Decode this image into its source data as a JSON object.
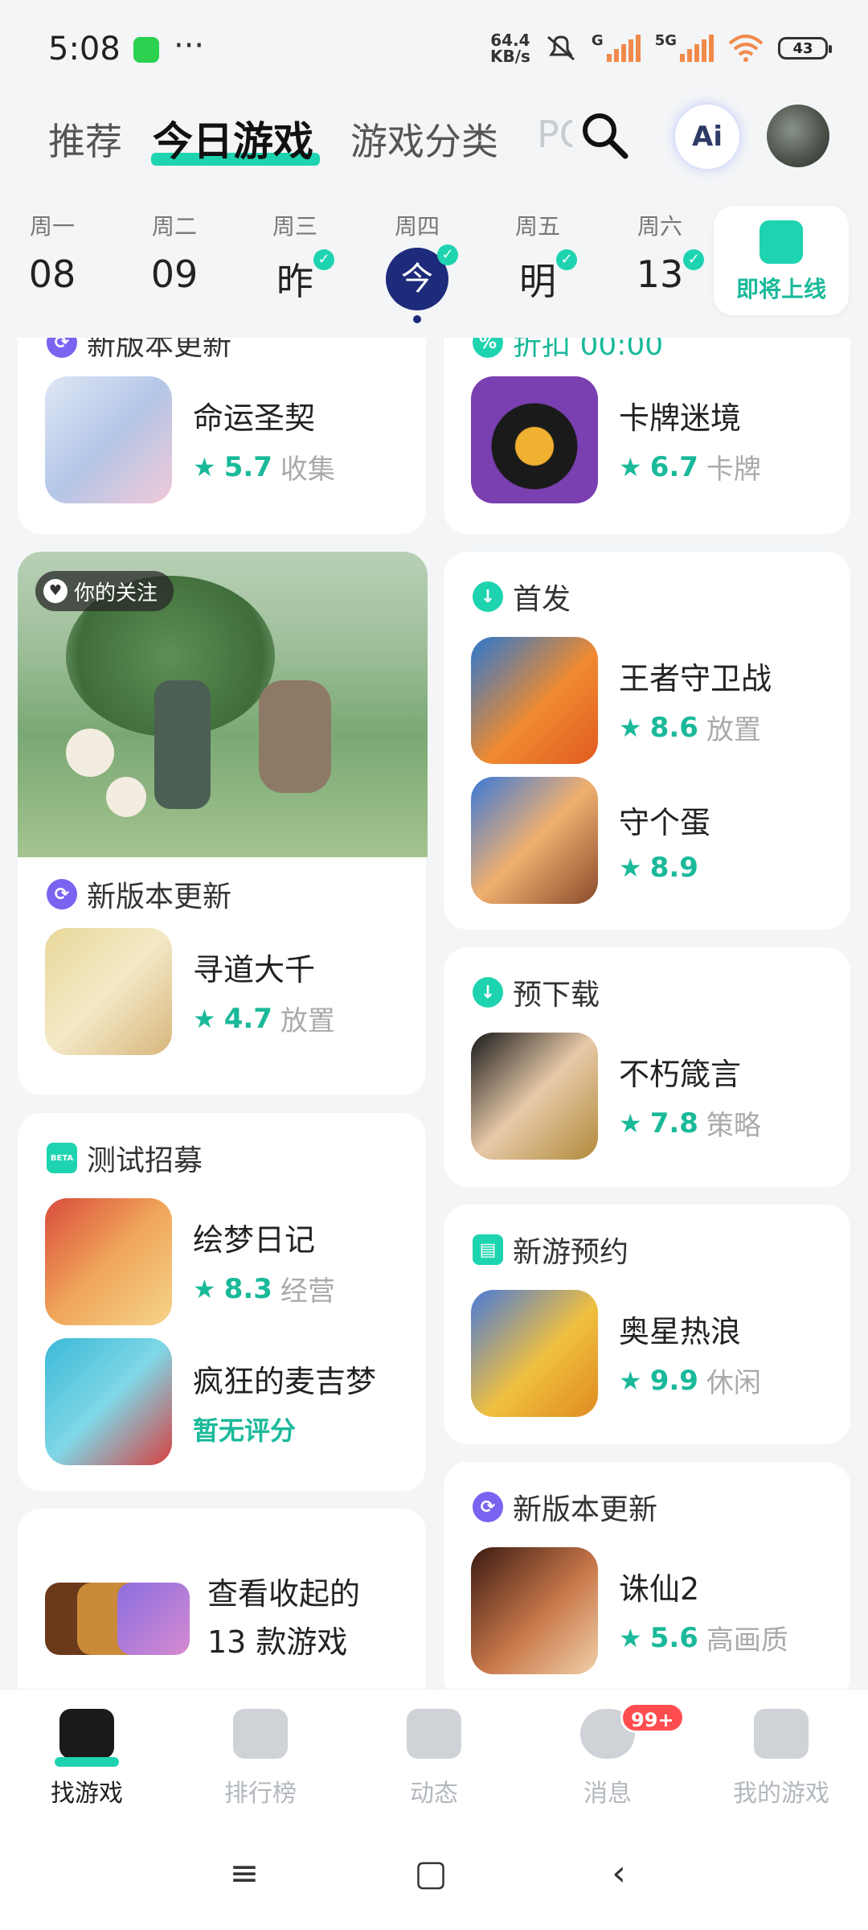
{
  "status_bar": {
    "time": "5:08",
    "net_speed_value": "64.4",
    "net_speed_unit": "KB/s",
    "gen_1": "G",
    "gen_2": "5G",
    "battery": "43"
  },
  "top_tabs": [
    {
      "label": "推荐",
      "active": false
    },
    {
      "label": "今日游戏",
      "active": true
    },
    {
      "label": "游戏分类",
      "active": false
    },
    {
      "label": "PC",
      "active": false
    }
  ],
  "ai_label": "Ai",
  "week": [
    {
      "name": "周一",
      "num": "08",
      "checked": false
    },
    {
      "name": "周二",
      "num": "09",
      "checked": false
    },
    {
      "name": "周三",
      "num": "昨",
      "checked": true
    },
    {
      "name": "周四",
      "num": "今",
      "checked": true,
      "today": true
    },
    {
      "name": "周五",
      "num": "明",
      "checked": true
    },
    {
      "name": "周六",
      "num": "13",
      "checked": true
    }
  ],
  "upcoming_label": "即将上线",
  "left_column": {
    "card1": {
      "header": "新版本更新",
      "game": {
        "name": "命运圣契",
        "score": "5.7",
        "genre": "收集"
      }
    },
    "hero": {
      "follow_label": "你的关注",
      "header": "新版本更新",
      "game": {
        "name": "寻道大千",
        "score": "4.7",
        "genre": "放置"
      }
    },
    "beta": {
      "header": "测试招募",
      "beta_tag": "BETA",
      "games": [
        {
          "name": "绘梦日记",
          "score": "8.3",
          "genre": "经营"
        },
        {
          "name": "疯狂的麦吉梦",
          "score": "",
          "genre": "",
          "no_rating": "暂无评分"
        }
      ]
    },
    "collapsed": {
      "line1": "查看收起的",
      "line2": "13 款游戏"
    }
  },
  "right_column": {
    "card1": {
      "header": "折扣 00:00",
      "game": {
        "name": "卡牌迷境",
        "score": "6.7",
        "genre": "卡牌"
      }
    },
    "first_release": {
      "header": "首发",
      "games": [
        {
          "name": "王者守卫战",
          "score": "8.6",
          "genre": "放置"
        },
        {
          "name": "守个蛋",
          "score": "8.9",
          "genre": ""
        }
      ]
    },
    "pre_download": {
      "header": "预下载",
      "game": {
        "name": "不朽箴言",
        "score": "7.8",
        "genre": "策略"
      }
    },
    "reservation": {
      "header": "新游预约",
      "game": {
        "name": "奥星热浪",
        "score": "9.9",
        "genre": "休闲"
      }
    },
    "update": {
      "header": "新版本更新",
      "game": {
        "name": "诛仙2",
        "score": "5.6",
        "genre": "高画质"
      }
    }
  },
  "bottom_nav": [
    {
      "label": "找游戏",
      "active": true
    },
    {
      "label": "排行榜",
      "active": false
    },
    {
      "label": "动态",
      "active": false
    },
    {
      "label": "消息",
      "active": false,
      "badge": "99+"
    },
    {
      "label": "我的游戏",
      "active": false
    }
  ],
  "colors": {
    "accent": "#1ed4b0",
    "today": "#1e2a7a",
    "badge": "#ff4d4f"
  }
}
